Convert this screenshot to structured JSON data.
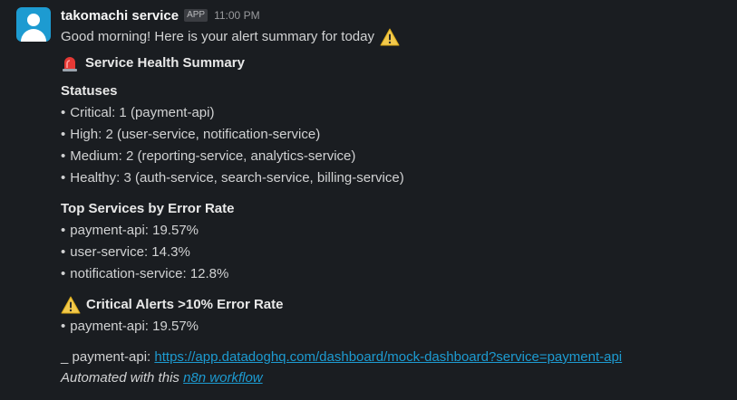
{
  "message": {
    "sender": "takomachi service",
    "badge": "APP",
    "time": "11:00 PM",
    "greeting": "Good morning! Here is your alert summary for today",
    "summary_title": "Service Health Summary",
    "statuses_title": "Statuses",
    "statuses": [
      "Critical: 1 (payment-api)",
      "High: 2 (user-service, notification-service)",
      "Medium: 2 (reporting-service, analytics-service)",
      "Healthy: 3 (auth-service, search-service, billing-service)"
    ],
    "bullet_char": "•",
    "top_services_title": "Top Services by Error Rate",
    "top_services": [
      "payment-api: 19.57%",
      "user-service: 14.3%",
      "notification-service: 12.8%"
    ],
    "critical_title": "Critical Alerts >10% Error Rate",
    "critical_alerts": [
      "payment-api: 19.57%"
    ],
    "dashboard_prefix": "_ payment-api: ",
    "dashboard_link": "https://app.datadoghq.com/dashboard/mock-dashboard?service=payment-api",
    "footer_prefix": "Automated with this ",
    "footer_link": "n8n workflow"
  },
  "icons": {
    "avatar": "user-avatar-icon",
    "warning": "warning-icon",
    "siren": "siren-icon"
  },
  "colors": {
    "background": "#1a1d21",
    "link": "#1d9bd1",
    "avatar": "#1d9bd1"
  }
}
